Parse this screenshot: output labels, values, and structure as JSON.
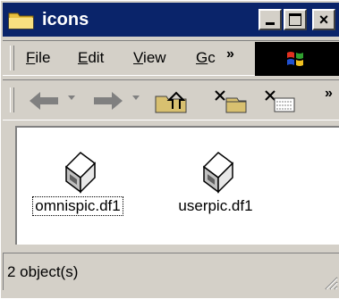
{
  "window": {
    "title": "icons"
  },
  "menu": {
    "file": {
      "accel": "F",
      "rest": "ile"
    },
    "edit": {
      "accel": "E",
      "rest": "dit"
    },
    "view": {
      "accel": "V",
      "rest": "iew"
    },
    "go": {
      "accel": "G",
      "rest": "c"
    },
    "overflow": "»"
  },
  "toolbar": {
    "overflow": "»",
    "buttons": [
      "back-icon",
      "forward-icon",
      "up-folder-icon",
      "cut-icon",
      "copy-icon"
    ]
  },
  "files": [
    {
      "name": "omnispic.df1",
      "icon": "drive-icon",
      "selected": true
    },
    {
      "name": "userpic.df1",
      "icon": "drive-icon",
      "selected": false
    }
  ],
  "status": {
    "text": "2 object(s)"
  },
  "colors": {
    "title_bar": "#0a246a",
    "chrome": "#d4d0c8",
    "content_bg": "#ffffff"
  }
}
